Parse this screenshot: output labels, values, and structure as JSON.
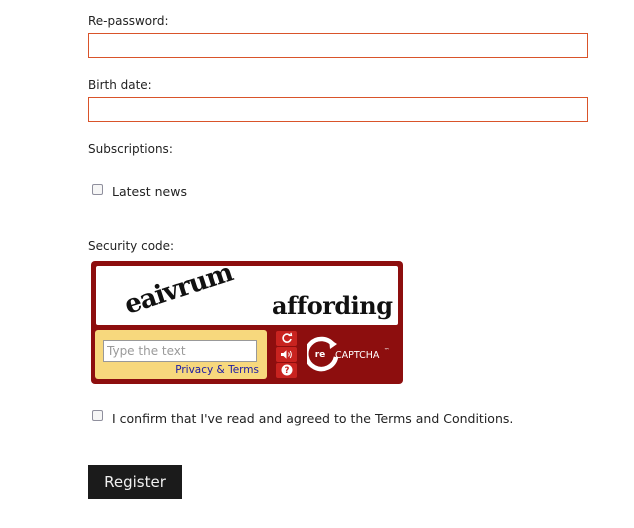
{
  "form": {
    "repassword_label": "Re-password:",
    "birthdate_label": "Birth date:",
    "subscriptions_label": "Subscriptions:",
    "latest_news_label": "Latest news",
    "security_code_label": "Security code:",
    "terms_label": "I confirm that I've read and agreed to the Terms and Conditions.",
    "register_label": "Register"
  },
  "recaptcha": {
    "word1": "eaivrum",
    "word2": "affording",
    "input_placeholder": "Type the text",
    "privacy_link": "Privacy & Terms",
    "logo_re": "re",
    "logo_captcha": "CAPTCHA",
    "logo_tm": "™",
    "icons": [
      "refresh-icon",
      "audio-icon",
      "help-icon"
    ]
  },
  "colors": {
    "field_border": "#d9532a",
    "recaptcha_bg": "#8d0e0e",
    "recaptcha_panel": "#f7d87d",
    "register_bg": "#1b1b1b"
  }
}
